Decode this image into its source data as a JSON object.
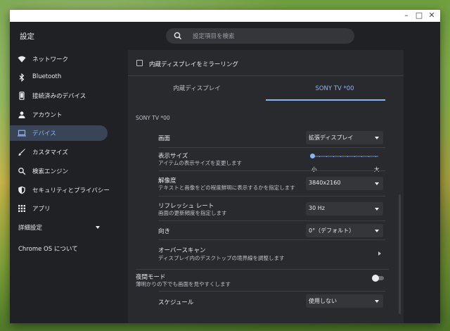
{
  "app": {
    "title": "設定"
  },
  "search": {
    "placeholder": "設定項目を検索"
  },
  "sidebar": {
    "items": [
      {
        "label": "ネットワーク",
        "icon": "wifi-icon"
      },
      {
        "label": "Bluetooth",
        "icon": "bluetooth-icon"
      },
      {
        "label": "接続済みのデバイス",
        "icon": "phone-icon"
      },
      {
        "label": "アカウント",
        "icon": "person-icon"
      },
      {
        "label": "デバイス",
        "icon": "laptop-icon",
        "active": true
      },
      {
        "label": "カスタマイズ",
        "icon": "brush-icon"
      },
      {
        "label": "検索エンジン",
        "icon": "search-icon"
      },
      {
        "label": "セキュリティとプライバシー",
        "icon": "shield-icon"
      },
      {
        "label": "アプリ",
        "icon": "grid-icon"
      }
    ],
    "advanced": "詳細設定",
    "about": "Chrome OS について"
  },
  "display": {
    "mirror_label": "内蔵ディスプレイをミラーリング",
    "tabs": [
      {
        "label": "内蔵ディスプレイ",
        "active": false
      },
      {
        "label": "SONY TV *00",
        "active": true
      }
    ],
    "section_title": "SONY TV *00",
    "screen": {
      "label": "画面",
      "value": "拡張ディスプレイ"
    },
    "display_size": {
      "label": "表示サイズ",
      "sub": "アイテムの表示サイズを変更します",
      "min_label": "小",
      "max_label": "大",
      "level": 0
    },
    "resolution": {
      "label": "解像度",
      "sub": "テキストと画像をどの程度鮮明に表示するかを指定します",
      "value": "3840x2160"
    },
    "refresh": {
      "label": "リフレッシュ レート",
      "sub": "画面の更新頻度を指定します",
      "value": "30 Hz"
    },
    "orientation": {
      "label": "向き",
      "value": "0°（デフォルト）"
    },
    "overscan": {
      "label": "オーバースキャン",
      "sub": "ディスプレイ内のデスクトップの境界線を調整します"
    },
    "night_mode": {
      "label": "夜間モード",
      "sub": "薄明かりの下でも画面を見やすくします",
      "enabled": false
    },
    "schedule": {
      "label": "スケジュール",
      "value": "使用しない"
    }
  },
  "colors": {
    "accent": "#8ab4f8",
    "active_nav_bg": "#394457",
    "panel_bg": "#292a2d",
    "window_bg": "#202124"
  }
}
